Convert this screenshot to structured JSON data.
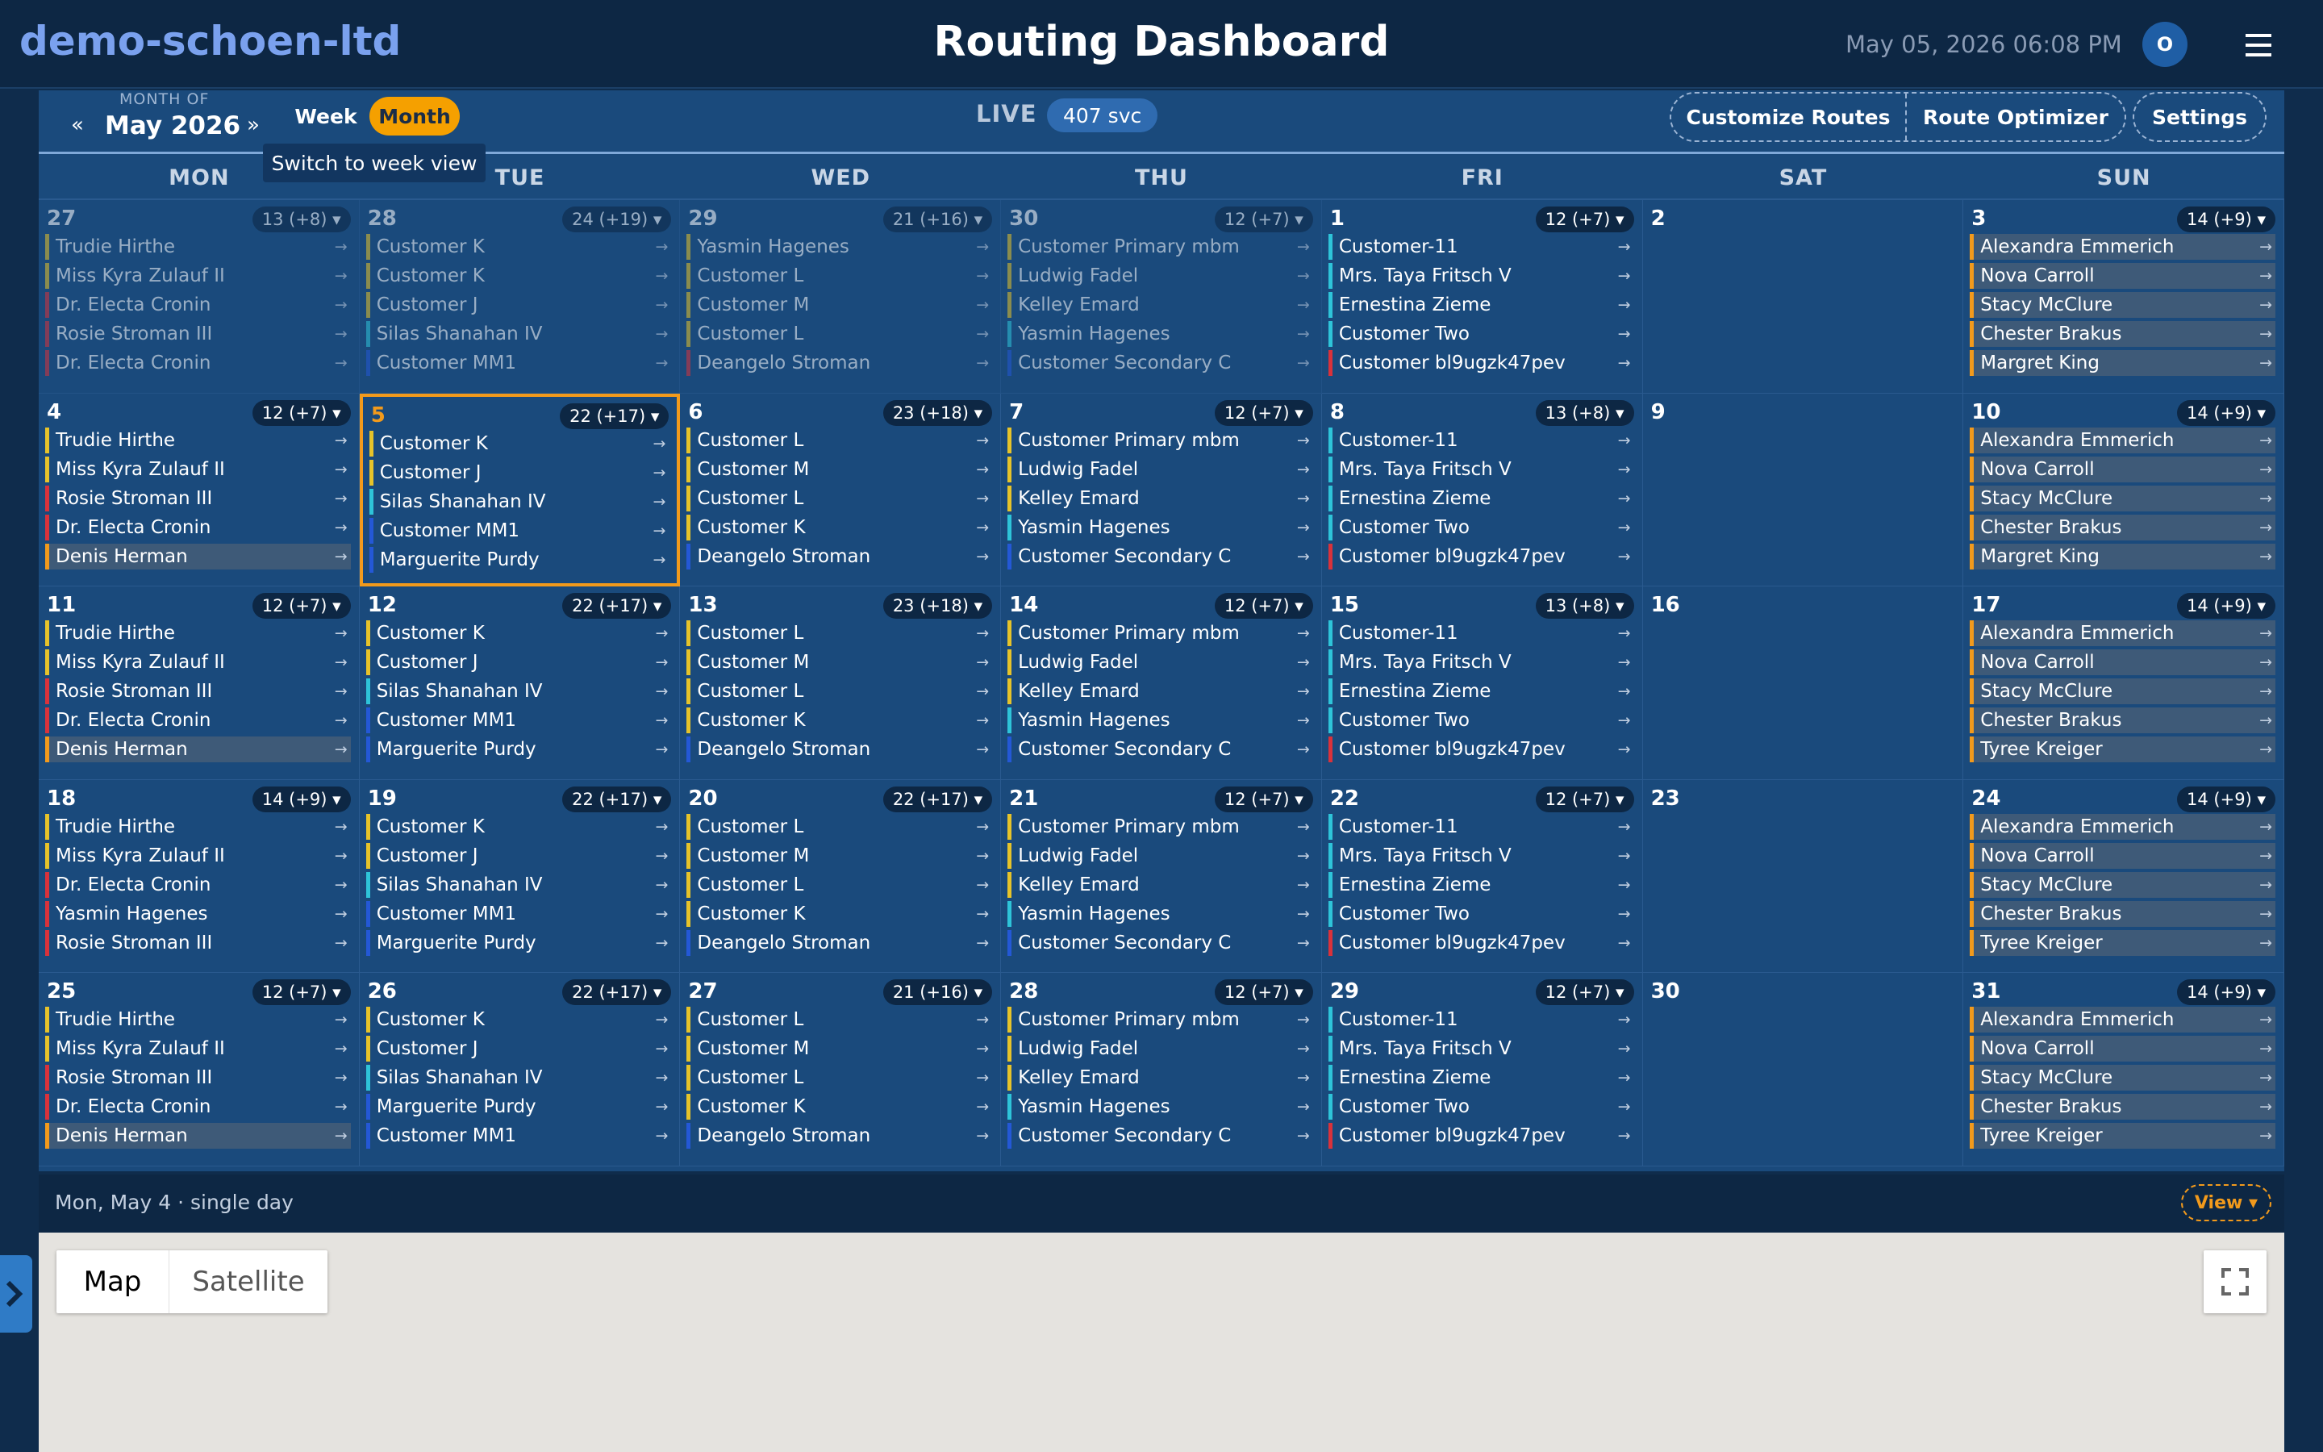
{
  "header": {
    "brand": "demo-schoen-ltd",
    "title": "Routing Dashboard",
    "datetime": "May 05, 2026 06:08 PM",
    "avatar": "O"
  },
  "toolbar": {
    "month_of": "MONTH OF",
    "month": "May 2026",
    "prev": "«",
    "next": "»",
    "week_label": "Week",
    "month_label": "Month",
    "tooltip": "Switch to week view",
    "live_label": "LIVE",
    "svc_count": "407 svc",
    "customize_routes": "Customize Routes",
    "route_optimizer": "Route Optimizer",
    "settings": "Settings"
  },
  "weekdays": [
    "MON",
    "TUE",
    "WED",
    "THU",
    "FRI",
    "SAT",
    "SUN"
  ],
  "colors": {
    "yellow": "#e6c32a",
    "cyan": "#2ec4d9",
    "red": "#d9323b",
    "blue": "#2458d6",
    "orange": "#f29a1c",
    "highlight": "#3e5a78"
  },
  "days": [
    {
      "num": "27",
      "badge": "13 (+8) ▾",
      "dim": true,
      "stops": [
        {
          "name": "Trudie Hirthe",
          "c": "yellow"
        },
        {
          "name": "Miss Kyra Zulauf II",
          "c": "yellow"
        },
        {
          "name": "Dr. Electa Cronin",
          "c": "red"
        },
        {
          "name": "Rosie Stroman III",
          "c": "red"
        },
        {
          "name": "Dr. Electa Cronin",
          "c": "red"
        }
      ]
    },
    {
      "num": "28",
      "badge": "24 (+19) ▾",
      "dim": true,
      "stops": [
        {
          "name": "Customer K",
          "c": "yellow"
        },
        {
          "name": "Customer K",
          "c": "yellow"
        },
        {
          "name": "Customer J",
          "c": "yellow"
        },
        {
          "name": "Silas Shanahan IV",
          "c": "cyan"
        },
        {
          "name": "Customer MM1",
          "c": "blue"
        }
      ]
    },
    {
      "num": "29",
      "badge": "21 (+16) ▾",
      "dim": true,
      "stops": [
        {
          "name": "Yasmin Hagenes",
          "c": "yellow"
        },
        {
          "name": "Customer L",
          "c": "yellow"
        },
        {
          "name": "Customer M",
          "c": "yellow"
        },
        {
          "name": "Customer L",
          "c": "yellow"
        },
        {
          "name": "Deangelo Stroman",
          "c": "red"
        }
      ]
    },
    {
      "num": "30",
      "badge": "12 (+7) ▾",
      "dim": true,
      "stops": [
        {
          "name": "Customer Primary mbm",
          "c": "yellow"
        },
        {
          "name": "Ludwig Fadel",
          "c": "yellow"
        },
        {
          "name": "Kelley Emard",
          "c": "yellow"
        },
        {
          "name": "Yasmin Hagenes",
          "c": "cyan"
        },
        {
          "name": "Customer Secondary C",
          "c": "blue"
        }
      ]
    },
    {
      "num": "1",
      "badge": "12 (+7) ▾",
      "stops": [
        {
          "name": "Customer-11",
          "c": "cyan"
        },
        {
          "name": "Mrs. Taya Fritsch V",
          "c": "cyan"
        },
        {
          "name": "Ernestina Zieme",
          "c": "cyan"
        },
        {
          "name": "Customer Two",
          "c": "cyan"
        },
        {
          "name": "Customer bl9ugzk47pev",
          "c": "red"
        }
      ]
    },
    {
      "num": "2",
      "badge": "",
      "stops": []
    },
    {
      "num": "3",
      "badge": "14 (+9) ▾",
      "stops": [
        {
          "name": "Alexandra Emmerich",
          "c": "orange",
          "hl": true
        },
        {
          "name": "Nova Carroll",
          "c": "orange",
          "hl": true
        },
        {
          "name": "Stacy McClure",
          "c": "orange",
          "hl": true
        },
        {
          "name": "Chester Brakus",
          "c": "orange",
          "hl": true
        },
        {
          "name": "Margret King",
          "c": "orange",
          "hl": true
        }
      ]
    },
    {
      "num": "4",
      "badge": "12 (+7) ▾",
      "stops": [
        {
          "name": "Trudie Hirthe",
          "c": "yellow"
        },
        {
          "name": "Miss Kyra Zulauf II",
          "c": "yellow"
        },
        {
          "name": "Rosie Stroman III",
          "c": "red"
        },
        {
          "name": "Dr. Electa Cronin",
          "c": "red"
        },
        {
          "name": "Denis Herman",
          "c": "orange",
          "hl": true
        }
      ]
    },
    {
      "num": "5",
      "badge": "22 (+17) ▾",
      "today": true,
      "stops": [
        {
          "name": "Customer K",
          "c": "yellow"
        },
        {
          "name": "Customer J",
          "c": "yellow"
        },
        {
          "name": "Silas Shanahan IV",
          "c": "cyan"
        },
        {
          "name": "Customer MM1",
          "c": "blue"
        },
        {
          "name": "Marguerite Purdy",
          "c": "blue"
        }
      ]
    },
    {
      "num": "6",
      "badge": "23 (+18) ▾",
      "stops": [
        {
          "name": "Customer L",
          "c": "yellow"
        },
        {
          "name": "Customer M",
          "c": "yellow"
        },
        {
          "name": "Customer L",
          "c": "yellow"
        },
        {
          "name": "Customer K",
          "c": "yellow"
        },
        {
          "name": "Deangelo Stroman",
          "c": "blue"
        }
      ]
    },
    {
      "num": "7",
      "badge": "12 (+7) ▾",
      "stops": [
        {
          "name": "Customer Primary mbm",
          "c": "yellow"
        },
        {
          "name": "Ludwig Fadel",
          "c": "yellow"
        },
        {
          "name": "Kelley Emard",
          "c": "yellow"
        },
        {
          "name": "Yasmin Hagenes",
          "c": "cyan"
        },
        {
          "name": "Customer Secondary C",
          "c": "blue"
        }
      ]
    },
    {
      "num": "8",
      "badge": "13 (+8) ▾",
      "stops": [
        {
          "name": "Customer-11",
          "c": "cyan"
        },
        {
          "name": "Mrs. Taya Fritsch V",
          "c": "cyan"
        },
        {
          "name": "Ernestina Zieme",
          "c": "cyan"
        },
        {
          "name": "Customer Two",
          "c": "cyan"
        },
        {
          "name": "Customer bl9ugzk47pev",
          "c": "red"
        }
      ]
    },
    {
      "num": "9",
      "badge": "",
      "stops": []
    },
    {
      "num": "10",
      "badge": "14 (+9) ▾",
      "stops": [
        {
          "name": "Alexandra Emmerich",
          "c": "orange",
          "hl": true
        },
        {
          "name": "Nova Carroll",
          "c": "orange",
          "hl": true
        },
        {
          "name": "Stacy McClure",
          "c": "orange",
          "hl": true
        },
        {
          "name": "Chester Brakus",
          "c": "orange",
          "hl": true
        },
        {
          "name": "Margret King",
          "c": "orange",
          "hl": true
        }
      ]
    },
    {
      "num": "11",
      "badge": "12 (+7) ▾",
      "stops": [
        {
          "name": "Trudie Hirthe",
          "c": "yellow"
        },
        {
          "name": "Miss Kyra Zulauf II",
          "c": "yellow"
        },
        {
          "name": "Rosie Stroman III",
          "c": "red"
        },
        {
          "name": "Dr. Electa Cronin",
          "c": "red"
        },
        {
          "name": "Denis Herman",
          "c": "orange",
          "hl": true
        }
      ]
    },
    {
      "num": "12",
      "badge": "22 (+17) ▾",
      "stops": [
        {
          "name": "Customer K",
          "c": "yellow"
        },
        {
          "name": "Customer J",
          "c": "yellow"
        },
        {
          "name": "Silas Shanahan IV",
          "c": "cyan"
        },
        {
          "name": "Customer MM1",
          "c": "blue"
        },
        {
          "name": "Marguerite Purdy",
          "c": "blue"
        }
      ]
    },
    {
      "num": "13",
      "badge": "23 (+18) ▾",
      "stops": [
        {
          "name": "Customer L",
          "c": "yellow"
        },
        {
          "name": "Customer M",
          "c": "yellow"
        },
        {
          "name": "Customer L",
          "c": "yellow"
        },
        {
          "name": "Customer K",
          "c": "yellow"
        },
        {
          "name": "Deangelo Stroman",
          "c": "blue"
        }
      ]
    },
    {
      "num": "14",
      "badge": "12 (+7) ▾",
      "stops": [
        {
          "name": "Customer Primary mbm",
          "c": "yellow"
        },
        {
          "name": "Ludwig Fadel",
          "c": "yellow"
        },
        {
          "name": "Kelley Emard",
          "c": "yellow"
        },
        {
          "name": "Yasmin Hagenes",
          "c": "cyan"
        },
        {
          "name": "Customer Secondary C",
          "c": "blue"
        }
      ]
    },
    {
      "num": "15",
      "badge": "13 (+8) ▾",
      "stops": [
        {
          "name": "Customer-11",
          "c": "cyan"
        },
        {
          "name": "Mrs. Taya Fritsch V",
          "c": "cyan"
        },
        {
          "name": "Ernestina Zieme",
          "c": "cyan"
        },
        {
          "name": "Customer Two",
          "c": "cyan"
        },
        {
          "name": "Customer bl9ugzk47pev",
          "c": "red"
        }
      ]
    },
    {
      "num": "16",
      "badge": "",
      "stops": []
    },
    {
      "num": "17",
      "badge": "14 (+9) ▾",
      "stops": [
        {
          "name": "Alexandra Emmerich",
          "c": "orange",
          "hl": true
        },
        {
          "name": "Nova Carroll",
          "c": "orange",
          "hl": true
        },
        {
          "name": "Stacy McClure",
          "c": "orange",
          "hl": true
        },
        {
          "name": "Chester Brakus",
          "c": "orange",
          "hl": true
        },
        {
          "name": "Tyree Kreiger",
          "c": "orange",
          "hl": true
        }
      ]
    },
    {
      "num": "18",
      "badge": "14 (+9) ▾",
      "stops": [
        {
          "name": "Trudie Hirthe",
          "c": "yellow"
        },
        {
          "name": "Miss Kyra Zulauf II",
          "c": "yellow"
        },
        {
          "name": "Dr. Electa Cronin",
          "c": "red"
        },
        {
          "name": "Yasmin Hagenes",
          "c": "red"
        },
        {
          "name": "Rosie Stroman III",
          "c": "red"
        }
      ]
    },
    {
      "num": "19",
      "badge": "22 (+17) ▾",
      "stops": [
        {
          "name": "Customer K",
          "c": "yellow"
        },
        {
          "name": "Customer J",
          "c": "yellow"
        },
        {
          "name": "Silas Shanahan IV",
          "c": "cyan"
        },
        {
          "name": "Customer MM1",
          "c": "blue"
        },
        {
          "name": "Marguerite Purdy",
          "c": "blue"
        }
      ]
    },
    {
      "num": "20",
      "badge": "22 (+17) ▾",
      "stops": [
        {
          "name": "Customer L",
          "c": "yellow"
        },
        {
          "name": "Customer M",
          "c": "yellow"
        },
        {
          "name": "Customer L",
          "c": "yellow"
        },
        {
          "name": "Customer K",
          "c": "yellow"
        },
        {
          "name": "Deangelo Stroman",
          "c": "blue"
        }
      ]
    },
    {
      "num": "21",
      "badge": "12 (+7) ▾",
      "stops": [
        {
          "name": "Customer Primary mbm",
          "c": "yellow"
        },
        {
          "name": "Ludwig Fadel",
          "c": "yellow"
        },
        {
          "name": "Kelley Emard",
          "c": "yellow"
        },
        {
          "name": "Yasmin Hagenes",
          "c": "cyan"
        },
        {
          "name": "Customer Secondary C",
          "c": "blue"
        }
      ]
    },
    {
      "num": "22",
      "badge": "12 (+7) ▾",
      "stops": [
        {
          "name": "Customer-11",
          "c": "cyan"
        },
        {
          "name": "Mrs. Taya Fritsch V",
          "c": "cyan"
        },
        {
          "name": "Ernestina Zieme",
          "c": "cyan"
        },
        {
          "name": "Customer Two",
          "c": "cyan"
        },
        {
          "name": "Customer bl9ugzk47pev",
          "c": "red"
        }
      ]
    },
    {
      "num": "23",
      "badge": "",
      "stops": []
    },
    {
      "num": "24",
      "badge": "14 (+9) ▾",
      "stops": [
        {
          "name": "Alexandra Emmerich",
          "c": "orange",
          "hl": true
        },
        {
          "name": "Nova Carroll",
          "c": "orange",
          "hl": true
        },
        {
          "name": "Stacy McClure",
          "c": "orange",
          "hl": true
        },
        {
          "name": "Chester Brakus",
          "c": "orange",
          "hl": true
        },
        {
          "name": "Tyree Kreiger",
          "c": "orange",
          "hl": true
        }
      ]
    },
    {
      "num": "25",
      "badge": "12 (+7) ▾",
      "stops": [
        {
          "name": "Trudie Hirthe",
          "c": "yellow"
        },
        {
          "name": "Miss Kyra Zulauf II",
          "c": "yellow"
        },
        {
          "name": "Rosie Stroman III",
          "c": "red"
        },
        {
          "name": "Dr. Electa Cronin",
          "c": "red"
        },
        {
          "name": "Denis Herman",
          "c": "orange",
          "hl": true
        }
      ]
    },
    {
      "num": "26",
      "badge": "22 (+17) ▾",
      "stops": [
        {
          "name": "Customer K",
          "c": "yellow"
        },
        {
          "name": "Customer J",
          "c": "yellow"
        },
        {
          "name": "Silas Shanahan IV",
          "c": "cyan"
        },
        {
          "name": "Marguerite Purdy",
          "c": "blue"
        },
        {
          "name": "Customer MM1",
          "c": "blue"
        }
      ]
    },
    {
      "num": "27",
      "badge": "21 (+16) ▾",
      "stops": [
        {
          "name": "Customer L",
          "c": "yellow"
        },
        {
          "name": "Customer M",
          "c": "yellow"
        },
        {
          "name": "Customer L",
          "c": "yellow"
        },
        {
          "name": "Customer K",
          "c": "yellow"
        },
        {
          "name": "Deangelo Stroman",
          "c": "blue"
        }
      ]
    },
    {
      "num": "28",
      "badge": "12 (+7) ▾",
      "stops": [
        {
          "name": "Customer Primary mbm",
          "c": "yellow"
        },
        {
          "name": "Ludwig Fadel",
          "c": "yellow"
        },
        {
          "name": "Kelley Emard",
          "c": "yellow"
        },
        {
          "name": "Yasmin Hagenes",
          "c": "cyan"
        },
        {
          "name": "Customer Secondary C",
          "c": "blue"
        }
      ]
    },
    {
      "num": "29",
      "badge": "12 (+7) ▾",
      "stops": [
        {
          "name": "Customer-11",
          "c": "cyan"
        },
        {
          "name": "Mrs. Taya Fritsch V",
          "c": "cyan"
        },
        {
          "name": "Ernestina Zieme",
          "c": "cyan"
        },
        {
          "name": "Customer Two",
          "c": "cyan"
        },
        {
          "name": "Customer bl9ugzk47pev",
          "c": "red"
        }
      ]
    },
    {
      "num": "30",
      "badge": "",
      "stops": []
    },
    {
      "num": "31",
      "badge": "14 (+9) ▾",
      "stops": [
        {
          "name": "Alexandra Emmerich",
          "c": "orange",
          "hl": true
        },
        {
          "name": "Nova Carroll",
          "c": "orange",
          "hl": true
        },
        {
          "name": "Stacy McClure",
          "c": "orange",
          "hl": true
        },
        {
          "name": "Chester Brakus",
          "c": "orange",
          "hl": true
        },
        {
          "name": "Tyree Kreiger",
          "c": "orange",
          "hl": true
        }
      ]
    }
  ],
  "bottom": {
    "selection": "Mon, May 4 · single day",
    "view_label": "View ▾"
  },
  "map": {
    "map_label": "Map",
    "satellite_label": "Satellite"
  },
  "icons": {
    "stop_arrow": "→",
    "side_tab": "chevron-right-icon",
    "fullscreen": "fullscreen-icon",
    "menu": "hamburger-menu-icon"
  }
}
